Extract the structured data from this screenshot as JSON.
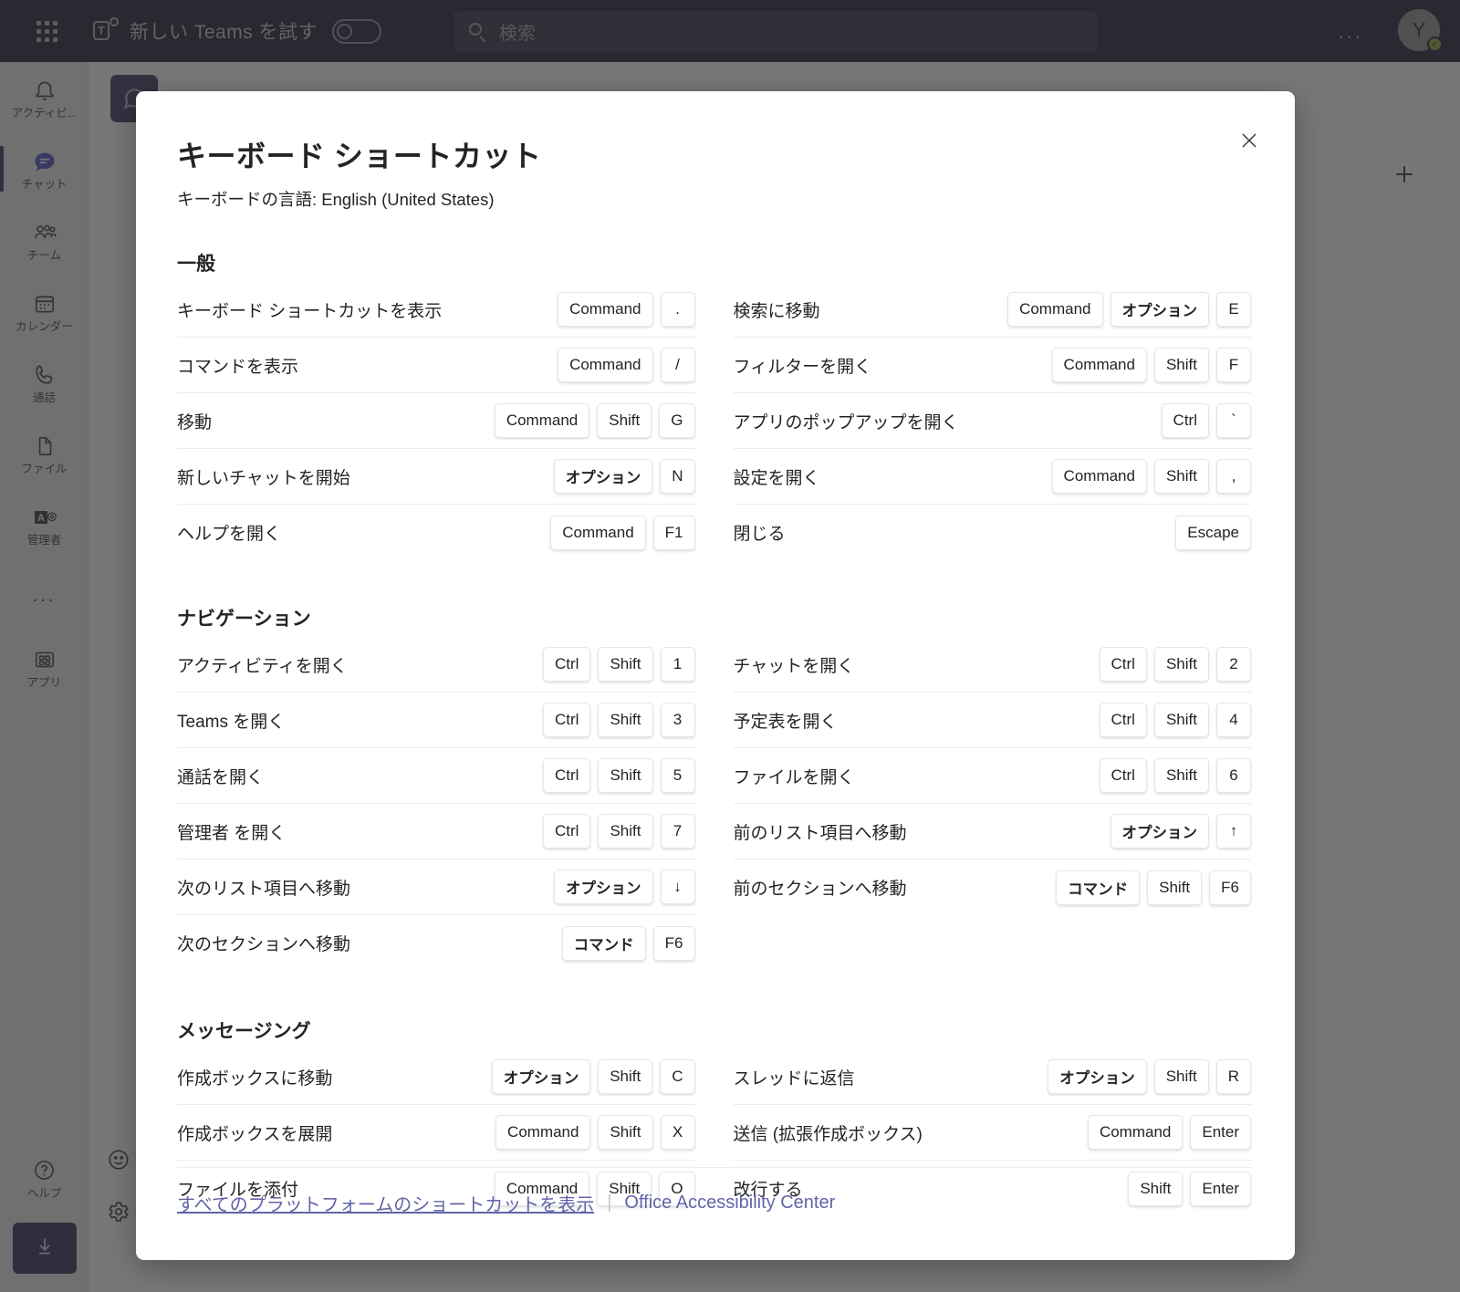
{
  "titlebar": {
    "waffle_icon": "app-launcher-icon",
    "teams_logo_letter": "T",
    "try_new_teams_label": "新しい Teams を試す",
    "toggle_state": "off",
    "search_placeholder": "検索",
    "more_options_label": "...",
    "avatar_initial": "Y",
    "presence": "available"
  },
  "rail": {
    "items": [
      {
        "label": "アクティビ...",
        "icon": "bell-icon",
        "active": false
      },
      {
        "label": "チャット",
        "icon": "chat-icon",
        "active": true
      },
      {
        "label": "チーム",
        "icon": "people-icon",
        "active": false
      },
      {
        "label": "カレンダー",
        "icon": "calendar-icon",
        "active": false
      },
      {
        "label": "通話",
        "icon": "phone-icon",
        "active": false
      },
      {
        "label": "ファイル",
        "icon": "file-icon",
        "active": false
      },
      {
        "label": "管理者",
        "icon": "admin-icon",
        "active": false
      },
      {
        "label": "...",
        "icon": "more-apps-icon",
        "active": false
      },
      {
        "label": "アプリ",
        "icon": "apps-grid-icon",
        "active": false
      }
    ],
    "help_label": "ヘルプ",
    "download_icon": "download-icon"
  },
  "background": {
    "plus_icon": "add-icon",
    "emoji_icon": "emoji-icon",
    "gear_icon": "gear-icon"
  },
  "dialog": {
    "title": "キーボード ショートカット",
    "subtitle": "キーボードの言語: English (United States)",
    "close_icon": "close-icon",
    "sections": [
      {
        "title": "一般",
        "left": [
          {
            "label": "キーボード ショートカットを表示",
            "keys": [
              "Command",
              "."
            ]
          },
          {
            "label": "コマンドを表示",
            "keys": [
              "Command",
              "/"
            ]
          },
          {
            "label": "移動",
            "keys": [
              "Command",
              "Shift",
              "G"
            ]
          },
          {
            "label": "新しいチャットを開始",
            "keys": [
              "オプション",
              "N"
            ]
          },
          {
            "label": "ヘルプを開く",
            "keys": [
              "Command",
              "F1"
            ]
          }
        ],
        "right": [
          {
            "label": "検索に移動",
            "keys": [
              "Command",
              "オプション",
              "E"
            ]
          },
          {
            "label": "フィルターを開く",
            "keys": [
              "Command",
              "Shift",
              "F"
            ]
          },
          {
            "label": "アプリのポップアップを開く",
            "keys": [
              "Ctrl",
              "`"
            ]
          },
          {
            "label": "設定を開く",
            "keys": [
              "Command",
              "Shift",
              ","
            ]
          },
          {
            "label": "閉じる",
            "keys": [
              "Escape"
            ]
          }
        ]
      },
      {
        "title": "ナビゲーション",
        "left": [
          {
            "label": "アクティビティを開く",
            "keys": [
              "Ctrl",
              "Shift",
              "1"
            ]
          },
          {
            "label": "Teams を開く",
            "keys": [
              "Ctrl",
              "Shift",
              "3"
            ]
          },
          {
            "label": "通話を開く",
            "keys": [
              "Ctrl",
              "Shift",
              "5"
            ]
          },
          {
            "label": "管理者 を開く",
            "keys": [
              "Ctrl",
              "Shift",
              "7"
            ]
          },
          {
            "label": "次のリスト項目へ移動",
            "keys": [
              "オプション",
              "↓"
            ]
          },
          {
            "label": "次のセクションへ移動",
            "keys": [
              "コマンド",
              "F6"
            ]
          }
        ],
        "right": [
          {
            "label": "チャットを開く",
            "keys": [
              "Ctrl",
              "Shift",
              "2"
            ]
          },
          {
            "label": "予定表を開く",
            "keys": [
              "Ctrl",
              "Shift",
              "4"
            ]
          },
          {
            "label": "ファイルを開く",
            "keys": [
              "Ctrl",
              "Shift",
              "6"
            ]
          },
          {
            "label": "前のリスト項目へ移動",
            "keys": [
              "オプション",
              "↑"
            ]
          },
          {
            "label": "前のセクションへ移動",
            "keys": [
              "コマンド",
              "Shift",
              "F6"
            ]
          }
        ]
      },
      {
        "title": "メッセージング",
        "left": [
          {
            "label": "作成ボックスに移動",
            "keys": [
              "オプション",
              "Shift",
              "C"
            ]
          },
          {
            "label": "作成ボックスを展開",
            "keys": [
              "Command",
              "Shift",
              "X"
            ]
          },
          {
            "label": "ファイルを添付",
            "keys": [
              "Command",
              "Shift",
              "O"
            ]
          }
        ],
        "right": [
          {
            "label": "スレッドに返信",
            "keys": [
              "オプション",
              "Shift",
              "R"
            ]
          },
          {
            "label": "送信 (拡張作成ボックス)",
            "keys": [
              "Command",
              "Enter"
            ]
          },
          {
            "label": "改行する",
            "keys": [
              "Shift",
              "Enter"
            ]
          }
        ]
      }
    ],
    "footer": {
      "all_platforms_link": "すべてのプラットフォームのショートカットを表示",
      "separator": "|",
      "accessibility_link": "Office Accessibility Center"
    }
  },
  "colors": {
    "titlebar_bg": "#33344a",
    "accent": "#6264a7",
    "rail_bg": "#ededed",
    "scrim": "rgba(37,36,35,0.62)",
    "presence_green": "#9aad4a"
  }
}
